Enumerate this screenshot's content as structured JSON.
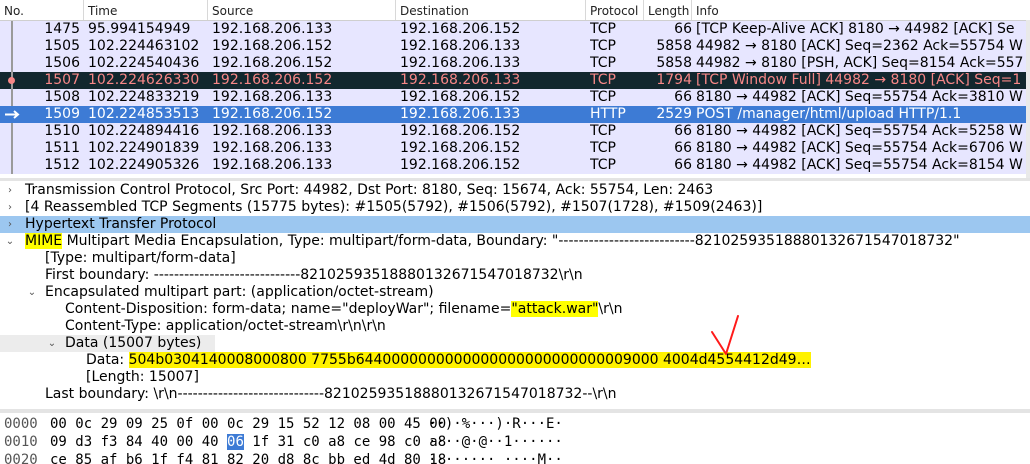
{
  "columns": [
    "No.",
    "Time",
    "Source",
    "Destination",
    "Protocol",
    "Length",
    "Info"
  ],
  "packets": [
    {
      "no": "1475",
      "time": "95.994154949",
      "src": "192.168.206.133",
      "dst": "192.168.206.152",
      "proto": "TCP",
      "len": "66",
      "info": "[TCP Keep-Alive ACK] 8180 → 44982 [ACK] Se"
    },
    {
      "no": "1505",
      "time": "102.224463102",
      "src": "192.168.206.152",
      "dst": "192.168.206.133",
      "proto": "TCP",
      "len": "5858",
      "info": "44982 → 8180 [ACK] Seq=2362 Ack=55754 W"
    },
    {
      "no": "1506",
      "time": "102.224540436",
      "src": "192.168.206.152",
      "dst": "192.168.206.133",
      "proto": "TCP",
      "len": "5858",
      "info": "44982 → 8180 [PSH, ACK] Seq=8154 Ack=557"
    },
    {
      "no": "1507",
      "time": "102.224626330",
      "src": "192.168.206.152",
      "dst": "192.168.206.133",
      "proto": "TCP",
      "len": "1794",
      "info": "[TCP Window Full] 44982 → 8180 [ACK] Seq=1"
    },
    {
      "no": "1508",
      "time": "102.224833219",
      "src": "192.168.206.133",
      "dst": "192.168.206.152",
      "proto": "TCP",
      "len": "66",
      "info": "8180 → 44982 [ACK] Seq=55754 Ack=3810 W"
    },
    {
      "no": "1509",
      "time": "102.224853513",
      "src": "192.168.206.152",
      "dst": "192.168.206.133",
      "proto": "HTTP",
      "len": "2529",
      "info": "POST /manager/html/upload HTTP/1.1"
    },
    {
      "no": "1510",
      "time": "102.224894416",
      "src": "192.168.206.133",
      "dst": "192.168.206.152",
      "proto": "TCP",
      "len": "66",
      "info": "8180 → 44982 [ACK] Seq=55754 Ack=5258 W"
    },
    {
      "no": "1511",
      "time": "102.224901839",
      "src": "192.168.206.133",
      "dst": "192.168.206.152",
      "proto": "TCP",
      "len": "66",
      "info": "8180 → 44982 [ACK] Seq=55754 Ack=6706 W"
    },
    {
      "no": "1512",
      "time": "102.224905326",
      "src": "192.168.206.133",
      "dst": "192.168.206.152",
      "proto": "TCP",
      "len": "66",
      "info": "8180 → 44982 [ACK] Seq=55754 Ack=8154 W"
    }
  ],
  "details": {
    "tcp": "Transmission Control Protocol, Src Port: 44982, Dst Port: 8180, Seq: 15674, Ack: 55754, Len: 2463",
    "reassembled": "[4 Reassembled TCP Segments (15775 bytes): #1505(5792), #1506(5792), #1507(1728), #1509(2463)]",
    "http": "Hypertext Transfer Protocol",
    "mime_highlight": "MIME",
    "mime_rest": " Multipart Media Encapsulation, Type: multipart/form-data, Boundary: \"---------------------------821025935188801326715470187​32\"",
    "type": "[Type: multipart/form-data]",
    "first_boundary": "First boundary: -----------------------------821025935188801326715470187​32\\r\\n",
    "encapsulated": "Encapsulated multipart part:  (application/octet-stream)",
    "disposition_pre": "Content-Disposition: form-data; name=\"deployWar\"; filename=",
    "filename": "\"attack.war\"",
    "disposition_post": "\\r\\n",
    "content_type": "Content-Type: application/octet-stream\\r\\n\\r\\n",
    "data_header": "Data (15007 bytes)",
    "data_label": "Data: ",
    "data_value": "504b0304140008000800 7755b6440000000000000000000000000009000 4004d4554412d49…",
    "data_length": "[Length: 15007]",
    "last_boundary": "Last boundary: \\r\\n-----------------------------821025935188801326715470187​32--\\r\\n"
  },
  "bytes": [
    {
      "off": "0000",
      "hex_a": "00 0c 29 09 25 0f 00 0c  29 15 52 12 08 00 45 00",
      "sel": "",
      "hex_b": "",
      "ascii": "··)·%···)·R···E·"
    },
    {
      "off": "0010",
      "hex_a": "09 d3 f3 84 40 00 40 ",
      "sel": "06",
      "hex_b": "  1f 31 c0 a8 ce 98 c0 a8",
      "ascii": "····@·@··1······"
    },
    {
      "off": "0020",
      "hex_a": "ce 85 af b6 1f f4 81 82  20 d8 8c bb ed 4d 80 18",
      "sel": "",
      "hex_b": "",
      "ascii": "········ ····M··"
    }
  ],
  "colors": {
    "tcp_row": "#e7e6ff",
    "http_selected": "#3d7bd5",
    "window_full_bg": "#12272e",
    "window_full_fg": "#f78787",
    "highlight": "#ffff00",
    "annotation": "#ff0000"
  }
}
